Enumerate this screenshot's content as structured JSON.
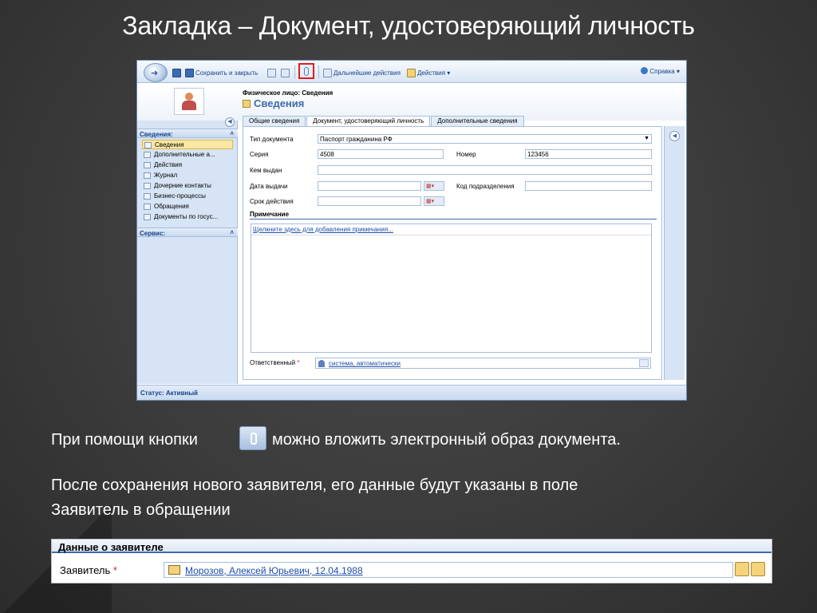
{
  "slide": {
    "title": "Закладка – Документ, удостоверяющий личность",
    "text_before_button": "При помощи кнопки",
    "text_after_button": "можно вложить электронный образ документа.",
    "paragraph_line1": "После сохранения нового заявителя, его данные будут указаны в поле",
    "paragraph_line2": "Заявитель в обращении"
  },
  "toolbar": {
    "save_close": "Сохранить и закрыть",
    "further_actions": "Дальнейшие действия",
    "actions": "Действия ▾",
    "help": "Справка ▾"
  },
  "record": {
    "entity": "Физическое лицо: Сведения",
    "title": "Сведения"
  },
  "nav": {
    "section1": "Сведения:",
    "items": [
      "Сведения",
      "Дополнительные а...",
      "Действия",
      "Журнал",
      "Дочерние контакты",
      "Бизнес-процессы",
      "Обращения",
      "Документы по госус..."
    ],
    "section2": "Сервис:"
  },
  "tabs": [
    "Общие сведения",
    "Документ, удостоверяющий личность",
    "Дополнительные сведения"
  ],
  "form": {
    "doc_type_label": "Тип документа",
    "doc_type_value": "Паспорт гражданина РФ",
    "series_label": "Серия",
    "series_value": "4508",
    "number_label": "Номер",
    "number_value": "123456",
    "issued_by_label": "Кем выдан",
    "issued_by_value": "",
    "issue_date_label": "Дата выдачи",
    "issue_date_value": "",
    "dept_code_label": "Код подразделения",
    "dept_code_value": "",
    "validity_label": "Срок действия",
    "validity_value": "",
    "notes_heading": "Примечание",
    "notes_link": "Щелкните здесь для добавления примечания...",
    "owner_label": "Ответственный",
    "owner_value": "система, автоматически",
    "required_mark": "*"
  },
  "status": "Статус: Активный",
  "applicant": {
    "heading": "Данные о заявителе",
    "label": "Заявитель",
    "required_mark": "*",
    "value": "Морозов, Алексей Юрьевич, 12.04.1988"
  }
}
